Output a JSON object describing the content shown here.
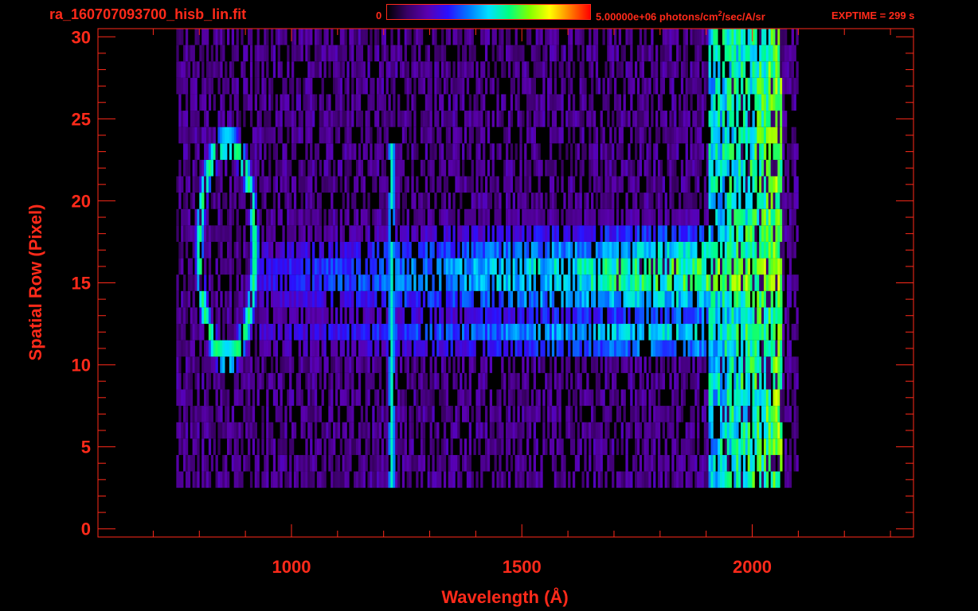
{
  "header": {
    "file_title": "ra_160707093700_hisb_lin.fit",
    "colorbar_min": "0",
    "colorbar_max_value": "5.00000e+06",
    "colorbar_units_prefix": " photons/cm",
    "colorbar_units_sup": "2",
    "colorbar_units_suffix": "/sec/A/sr",
    "exptime": "EXPTIME = 299 s"
  },
  "colors": {
    "foreground": "#ff2a1a",
    "background": "#000000",
    "colormap": [
      "#000000",
      "#3a0066",
      "#5a00b0",
      "#2a10ff",
      "#0078ff",
      "#00e0ff",
      "#00ff80",
      "#80ff00",
      "#ffff00",
      "#ff8000",
      "#ff0000"
    ]
  },
  "chart_data": {
    "type": "heatmap",
    "title": "ra_160707093700_hisb_lin.fit",
    "xlabel": "Wavelength (Å)",
    "ylabel": "Spatial Row (Pixel)",
    "xlim": [
      580,
      2350
    ],
    "ylim": [
      -0.5,
      30.5
    ],
    "xticks": [
      1000,
      1500,
      2000
    ],
    "yticks": [
      0,
      5,
      10,
      15,
      20,
      25,
      30
    ],
    "colorbar": {
      "min": 0,
      "max": 5000000,
      "units": "photons/cm^2/sec/A/sr",
      "scale": "linear"
    },
    "grid": false,
    "data_extent": {
      "x_min": 750,
      "x_max": 2100,
      "row_min": 3,
      "row_max": 30
    },
    "features": [
      {
        "name": "ring",
        "x_center": 858,
        "row_center": 17,
        "x_radius": 60,
        "row_radius": 6.5,
        "intensity": 0.62
      },
      {
        "name": "vertical line",
        "x": 1215,
        "row_min": 3,
        "row_max": 24,
        "intensity": 0.55
      },
      {
        "name": "continuum",
        "x_start": 930,
        "x_end": 2060,
        "row_min": 11,
        "row_max": 20,
        "intensity_start": 0.3,
        "intensity_end": 0.75
      },
      {
        "name": "edge band",
        "x_min": 2045,
        "x_max": 2060,
        "row_min": 1,
        "row_max": 30,
        "intensity": 0.78
      }
    ]
  }
}
